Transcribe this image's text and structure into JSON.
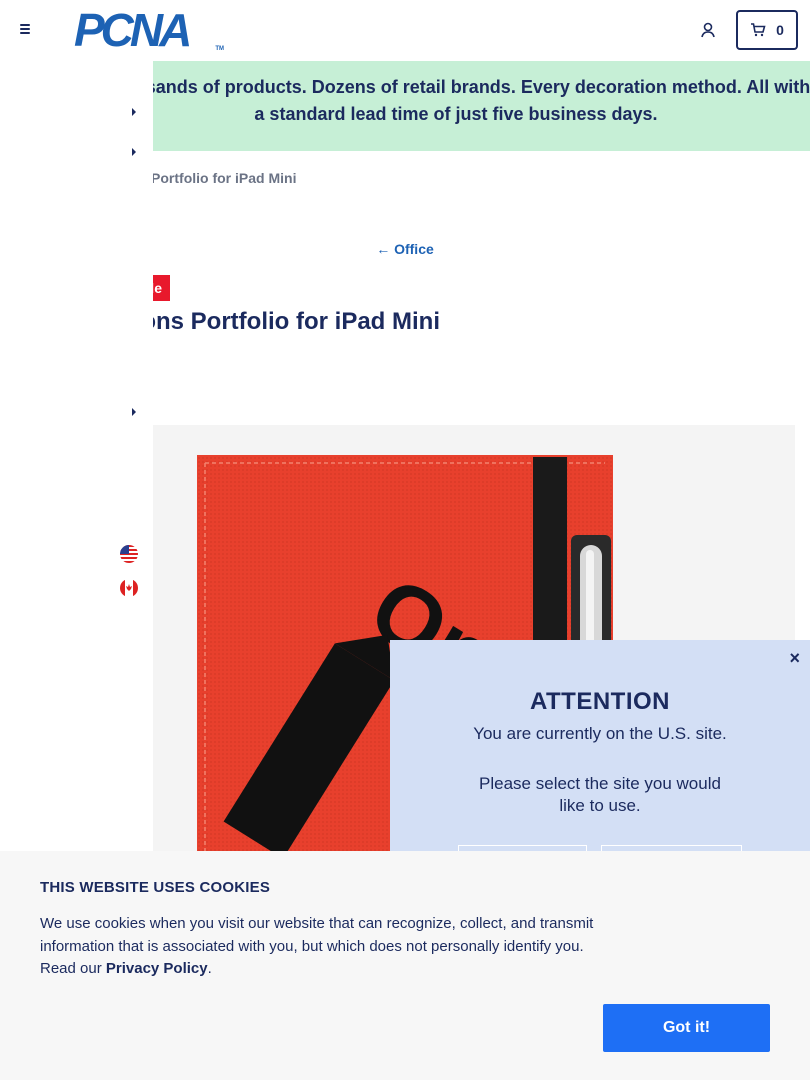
{
  "header": {
    "logo_text": "PCNA",
    "logo_tm": "TM",
    "cart_count": "0"
  },
  "banner": {
    "text": "Thousands of products. Dozens of retail brands. Every decoration method. All with a standard lead time of just five business days."
  },
  "breadcrumb": {
    "text": "Intersections Portfolio for iPad Mini"
  },
  "back_link": {
    "label": "Office"
  },
  "product": {
    "badge": "Sale",
    "title": "Intersections Portfolio for iPad Mini",
    "imprint_text": "One"
  },
  "site_select": {
    "flags": [
      "us-flag-icon",
      "canada-flag-icon"
    ]
  },
  "attention": {
    "close": "×",
    "title": "ATTENTION",
    "line1": "You are currently on the U.S. site.",
    "line2": "Please select the site you would like to use."
  },
  "cookie": {
    "title": "THIS WEBSITE USES COOKIES",
    "text": "We use cookies when you visit our website that can recognize, collect, and transmit information that is associated with you, but which does not personally identify you. Read our ",
    "link": "Privacy Policy",
    "period": ".",
    "button": "Got it!"
  },
  "colors": {
    "navy": "#1b2a5e",
    "brand_blue": "#1d62b4",
    "banner_green": "#c6efd6",
    "sale_red": "#e8192c",
    "modal_blue": "#d3dff5",
    "button_blue": "#1e6ff5",
    "product_red": "#e8402d"
  }
}
